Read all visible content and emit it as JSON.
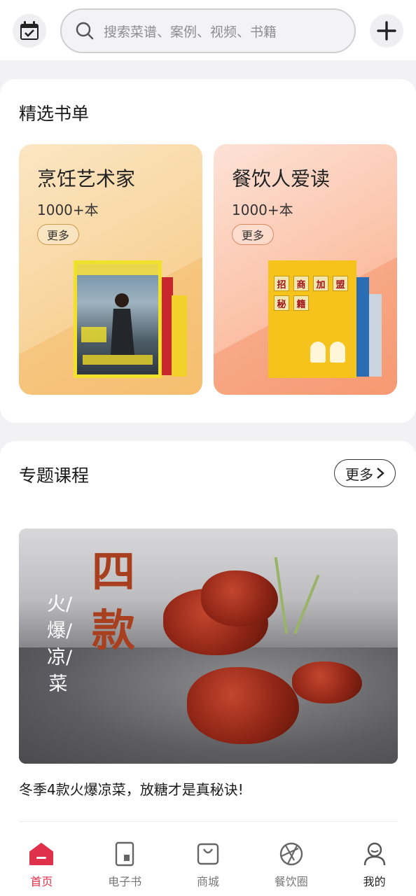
{
  "header": {
    "calendar_icon": "calendar-check-icon",
    "search_placeholder": "搜索菜谱、案例、视频、书籍",
    "add_icon": "plus-icon"
  },
  "booklist": {
    "title": "精选书单",
    "cards": [
      {
        "title": "烹饪艺术家",
        "count": "1000+本",
        "more": "更多"
      },
      {
        "title": "餐饮人爱读",
        "count": "1000+本",
        "more": "更多"
      }
    ],
    "cover2_grid": [
      "招",
      "商",
      "加",
      "盟",
      "秘",
      "籍"
    ]
  },
  "courses": {
    "title": "专题课程",
    "more": "更多",
    "banner_vertical_text": "火/爆/凉/菜",
    "banner_big_text": "四款",
    "caption": "冬季4款火爆凉菜，放糖才是真秘诀!"
  },
  "tabbar": {
    "items": [
      {
        "label": "首页",
        "icon": "home-icon",
        "active": true
      },
      {
        "label": "电子书",
        "icon": "ebook-icon"
      },
      {
        "label": "商城",
        "icon": "shopping-bag-icon"
      },
      {
        "label": "餐饮圈",
        "icon": "aperture-icon"
      },
      {
        "label": "我的",
        "icon": "user-icon"
      }
    ]
  },
  "colors": {
    "accent": "#e0314b"
  }
}
